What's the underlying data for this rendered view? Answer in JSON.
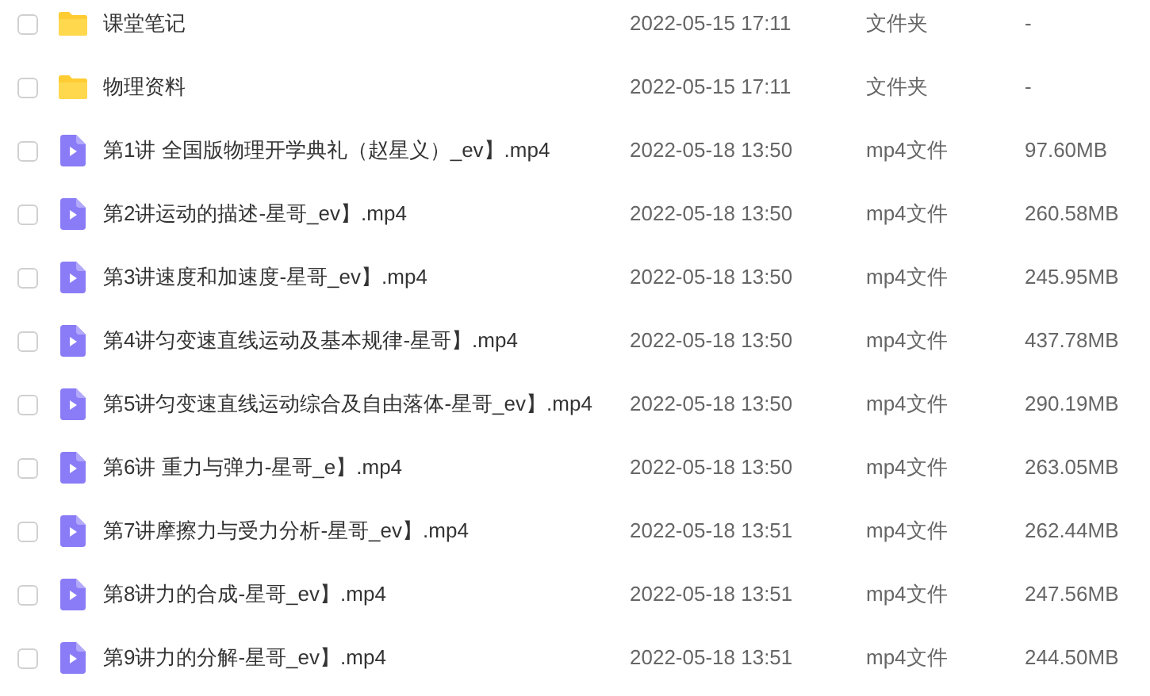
{
  "files": [
    {
      "kind": "folder",
      "checked": false,
      "name": "课堂笔记",
      "modified": "2022-05-15 17:11",
      "type": "文件夹",
      "size": "-"
    },
    {
      "kind": "folder",
      "checked": false,
      "name": "物理资料",
      "modified": "2022-05-15 17:11",
      "type": "文件夹",
      "size": "-"
    },
    {
      "kind": "video",
      "checked": false,
      "name": "第1讲 全国版物理开学典礼（赵星义）_ev】.mp4",
      "modified": "2022-05-18 13:50",
      "type": "mp4文件",
      "size": "97.60MB"
    },
    {
      "kind": "video",
      "checked": false,
      "name": "第2讲运动的描述-星哥_ev】.mp4",
      "modified": "2022-05-18 13:50",
      "type": "mp4文件",
      "size": "260.58MB"
    },
    {
      "kind": "video",
      "checked": false,
      "name": "第3讲速度和加速度-星哥_ev】.mp4",
      "modified": "2022-05-18 13:50",
      "type": "mp4文件",
      "size": "245.95MB"
    },
    {
      "kind": "video",
      "checked": false,
      "name": "第4讲匀变速直线运动及基本规律-星哥】.mp4",
      "modified": "2022-05-18 13:50",
      "type": "mp4文件",
      "size": "437.78MB"
    },
    {
      "kind": "video",
      "checked": false,
      "name": "第5讲匀变速直线运动综合及自由落体-星哥_ev】.mp4",
      "modified": "2022-05-18 13:50",
      "type": "mp4文件",
      "size": "290.19MB"
    },
    {
      "kind": "video",
      "checked": false,
      "name": "第6讲 重力与弹力-星哥_e】.mp4",
      "modified": "2022-05-18 13:50",
      "type": "mp4文件",
      "size": "263.05MB"
    },
    {
      "kind": "video",
      "checked": false,
      "name": "第7讲摩擦力与受力分析-星哥_ev】.mp4",
      "modified": "2022-05-18 13:51",
      "type": "mp4文件",
      "size": "262.44MB"
    },
    {
      "kind": "video",
      "checked": false,
      "name": "第8讲力的合成-星哥_ev】.mp4",
      "modified": "2022-05-18 13:51",
      "type": "mp4文件",
      "size": "247.56MB"
    },
    {
      "kind": "video",
      "checked": false,
      "name": "第9讲力的分解-星哥_ev】.mp4",
      "modified": "2022-05-18 13:51",
      "type": "mp4文件",
      "size": "244.50MB"
    }
  ]
}
